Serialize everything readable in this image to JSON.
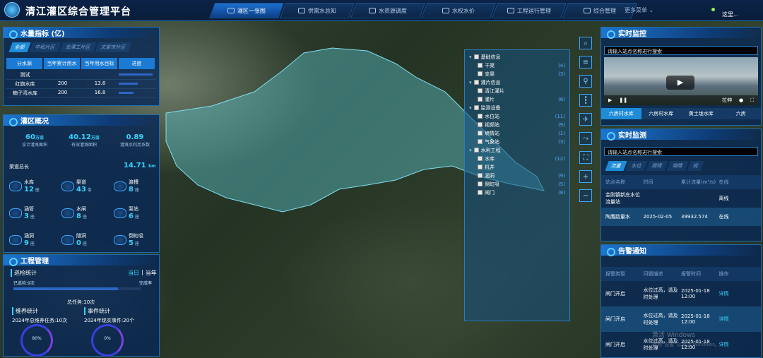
{
  "app_title": "清江灌区综合管理平台",
  "nav": [
    {
      "label": "灌区一张图",
      "icon": "map-icon",
      "active": true
    },
    {
      "label": "供需水总知",
      "icon": "flow-icon"
    },
    {
      "label": "水资源调度",
      "icon": "dispatch-icon"
    },
    {
      "label": "水权水价",
      "icon": "price-icon"
    },
    {
      "label": "工程运行管理",
      "icon": "project-icon"
    },
    {
      "label": "综合管理",
      "icon": "manage-icon"
    }
  ],
  "nav_more": "更多菜单 ⌄",
  "user": "这里...",
  "water": {
    "title": "水量指标 (亿)",
    "tabs": [
      "全部",
      "中和片区",
      "龙潭工片区",
      "文家市片区"
    ],
    "columns": [
      "分水源",
      "当年累计用水",
      "当年用水目标",
      "进度"
    ],
    "rows": [
      {
        "name": "测试",
        "used": "",
        "target": "",
        "progress": "0.9"
      },
      {
        "name": "红旗水库",
        "used": "200",
        "target": "13.8",
        "progress": "0.5"
      },
      {
        "name": "楠子湾水库",
        "used": "200",
        "target": "16.8",
        "progress": "0.4"
      }
    ]
  },
  "overview": {
    "title": "灌区概况",
    "stats": [
      {
        "value": "60",
        "unit": "万亩",
        "label": "设计灌溉面积"
      },
      {
        "value": "40.12",
        "unit": "万亩",
        "label": "有效灌溉面积"
      },
      {
        "value": "0.89",
        "unit": "",
        "label": "灌溉水利用系数"
      }
    ],
    "canal_label": "渠道总长",
    "canal_value": "14.71",
    "canal_unit": "km",
    "items": [
      {
        "label": "水库",
        "value": "12",
        "unit": "座"
      },
      {
        "label": "渠道",
        "value": "43",
        "unit": "条"
      },
      {
        "label": "渡槽",
        "value": "8",
        "unit": "座"
      },
      {
        "label": "涵管",
        "value": "3",
        "unit": "座"
      },
      {
        "label": "水闸",
        "value": "8",
        "unit": "座"
      },
      {
        "label": "泵站",
        "value": "6",
        "unit": "座"
      },
      {
        "label": "涵洞",
        "value": "9",
        "unit": "座"
      },
      {
        "label": "隧洞",
        "value": "0",
        "unit": "座"
      },
      {
        "label": "倒虹吸",
        "value": "5",
        "unit": "座"
      }
    ]
  },
  "engineering": {
    "title": "工程管理",
    "inspection": "巡检统计",
    "period_tabs": [
      "当日",
      "当年"
    ],
    "inspected": "已巡检:9次",
    "completion": "完成率",
    "total_tasks": "总任务:10次",
    "maint_title": "维养统计",
    "maint_text": "2024年总维养任务:10次",
    "event_title": "事件统计",
    "event_text": "2024年现实事件:20个",
    "gauge1": "80%",
    "gauge2": "0%"
  },
  "tree": [
    {
      "label": "基础信息",
      "level": 0,
      "count": ""
    },
    {
      "label": "干渠",
      "level": 1,
      "count": "(4)"
    },
    {
      "label": "支渠",
      "level": 1,
      "count": "(3)"
    },
    {
      "label": "灌片信息",
      "level": 0,
      "count": ""
    },
    {
      "label": "清江灌片",
      "level": 1,
      "count": ""
    },
    {
      "label": "灌片",
      "level": 1,
      "count": "(6)"
    },
    {
      "label": "监测设备",
      "level": 0,
      "count": ""
    },
    {
      "label": "水位站",
      "level": 1,
      "count": "(11)"
    },
    {
      "label": "视频站",
      "level": 1,
      "count": "(9)"
    },
    {
      "label": "墒情站",
      "level": 1,
      "count": "(1)"
    },
    {
      "label": "气象站",
      "level": 1,
      "count": "(3)"
    },
    {
      "label": "水利工程",
      "level": 0,
      "count": ""
    },
    {
      "label": "水库",
      "level": 1,
      "count": "(12)"
    },
    {
      "label": "机井",
      "level": 1,
      "count": ""
    },
    {
      "label": "涵洞",
      "level": 1,
      "count": "(9)"
    },
    {
      "label": "倒虹吸",
      "level": 1,
      "count": "(5)"
    },
    {
      "label": "闸门",
      "level": 1,
      "count": "(8)"
    }
  ],
  "monitor": {
    "title": "实时监控",
    "placeholder": "请输入站点名称进行搜索",
    "speed": "拉伸",
    "tabs": [
      "六房村水库",
      "六房村水库",
      "黄土垅水库",
      "六房"
    ]
  },
  "measure": {
    "title": "实时监测",
    "placeholder": "请输入站点名称进行搜索",
    "tabs": [
      "流量",
      "水位",
      "雨情",
      "墒情",
      "视"
    ],
    "columns": [
      "站点名称",
      "时间",
      "累计流量(m³/s)",
      "在线"
    ],
    "rows": [
      {
        "name": "金刚镇新庄水位流量站",
        "time": "",
        "flow": "",
        "status": "离线"
      },
      {
        "name": "陶鹰路量水",
        "time": "2025-02-05",
        "flow": "39932.574",
        "status": "在线"
      }
    ]
  },
  "alarm": {
    "title": "告警通知",
    "columns": [
      "报警类型",
      "问题描述",
      "报警时间",
      "操作"
    ],
    "rows": [
      {
        "type": "闸门开启",
        "desc": "水位过高，请及时处理",
        "time": "2025-01-18 12:00",
        "op": "详情"
      },
      {
        "type": "闸门开启",
        "desc": "水位过高，请及时处理",
        "time": "2025-01-18 12:00",
        "op": "详情"
      },
      {
        "type": "闸门开启",
        "desc": "水位过高，请及时处理",
        "time": "2025-01-18 12:00",
        "op": "详情"
      }
    ]
  },
  "watermark": "激活 Windows",
  "watermark_sub": "转到\"设置\"以激活 Windows。"
}
